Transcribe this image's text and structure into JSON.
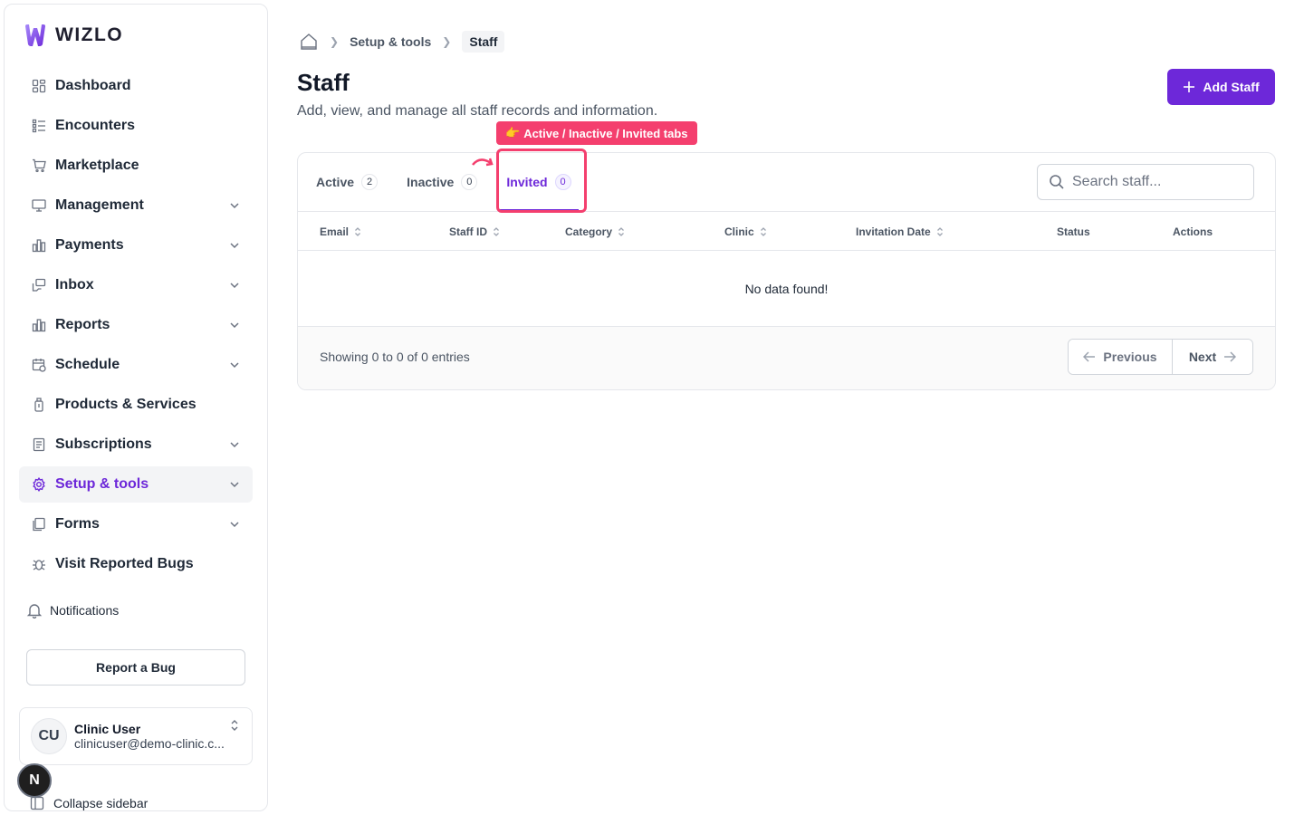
{
  "brand": {
    "name": "WIZLO",
    "accent": "#6d28d9",
    "highlight": "#f43f6e"
  },
  "sidebar": {
    "items": [
      {
        "label": "Dashboard",
        "icon": "dashboard-icon",
        "chevron": false
      },
      {
        "label": "Encounters",
        "icon": "encounters-icon",
        "chevron": false
      },
      {
        "label": "Marketplace",
        "icon": "cart-icon",
        "chevron": false
      },
      {
        "label": "Management",
        "icon": "monitor-icon",
        "chevron": true
      },
      {
        "label": "Payments",
        "icon": "bar-chart-icon",
        "chevron": true
      },
      {
        "label": "Inbox",
        "icon": "inbox-icon",
        "chevron": true
      },
      {
        "label": "Reports",
        "icon": "reports-icon",
        "chevron": true
      },
      {
        "label": "Schedule",
        "icon": "calendar-icon",
        "chevron": true
      },
      {
        "label": "Products & Services",
        "icon": "bottle-icon",
        "chevron": false
      },
      {
        "label": "Subscriptions",
        "icon": "receipt-icon",
        "chevron": true
      },
      {
        "label": "Setup & tools",
        "icon": "gear-icon",
        "chevron": true,
        "active": true
      },
      {
        "label": "Forms",
        "icon": "forms-icon",
        "chevron": true
      },
      {
        "label": "Visit Reported Bugs",
        "icon": "bug-icon",
        "chevron": false
      }
    ],
    "notifications_label": "Notifications",
    "report_bug_label": "Report a Bug",
    "user": {
      "initials": "CU",
      "name": "Clinic User",
      "email": "clinicuser@demo-clinic.c..."
    },
    "n_badge": "N",
    "collapse_label": "Collapse sidebar"
  },
  "breadcrumb": {
    "parent": "Setup & tools",
    "current": "Staff"
  },
  "page": {
    "title": "Staff",
    "subtitle": "Add, view, and manage all staff records and information.",
    "add_button": "Add Staff"
  },
  "hint": {
    "emoji": "👉",
    "text": "Active / Inactive / Invited tabs"
  },
  "tabs": [
    {
      "label": "Active",
      "count": "2"
    },
    {
      "label": "Inactive",
      "count": "0"
    },
    {
      "label": "Invited",
      "count": "0",
      "active": true
    }
  ],
  "search": {
    "placeholder": "Search staff...",
    "value": ""
  },
  "table": {
    "columns": [
      {
        "label": "Email",
        "sortable": true
      },
      {
        "label": "Staff ID",
        "sortable": true
      },
      {
        "label": "Category",
        "sortable": true
      },
      {
        "label": "Clinic",
        "sortable": true
      },
      {
        "label": "Invitation Date",
        "sortable": true
      },
      {
        "label": "Status",
        "sortable": false
      },
      {
        "label": "Actions",
        "sortable": false
      }
    ],
    "empty_message": "No data found!"
  },
  "pagination": {
    "summary": "Showing 0 to 0 of 0 entries",
    "previous": "Previous",
    "next": "Next"
  }
}
